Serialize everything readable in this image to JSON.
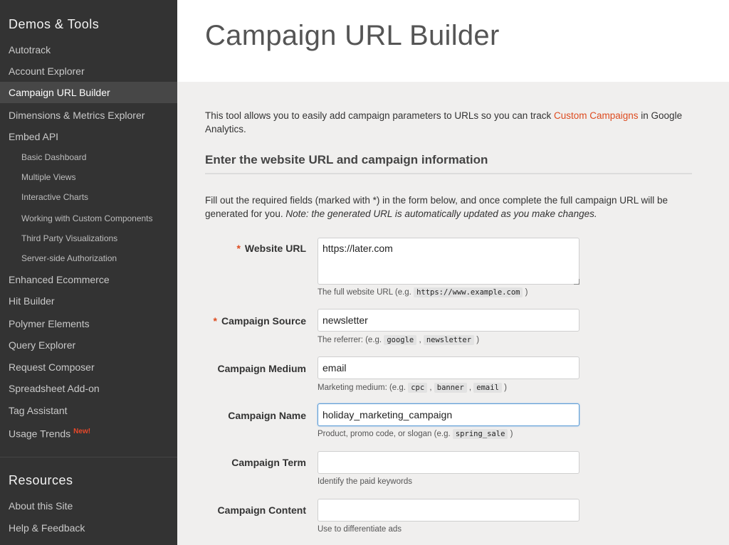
{
  "sidebar": {
    "heading": "Demos & Tools",
    "items": [
      {
        "label": "Autotrack"
      },
      {
        "label": "Account Explorer"
      },
      {
        "label": "Campaign URL Builder"
      },
      {
        "label": "Dimensions & Metrics Explorer"
      },
      {
        "label": "Embed API"
      },
      {
        "label": "Basic Dashboard"
      },
      {
        "label": "Multiple Views"
      },
      {
        "label": "Interactive Charts"
      },
      {
        "label": "Working with Custom Components"
      },
      {
        "label": "Third Party Visualizations"
      },
      {
        "label": "Server-side Authorization"
      },
      {
        "label": "Enhanced Ecommerce"
      },
      {
        "label": "Hit Builder"
      },
      {
        "label": "Polymer Elements"
      },
      {
        "label": "Query Explorer"
      },
      {
        "label": "Request Composer"
      },
      {
        "label": "Spreadsheet Add-on"
      },
      {
        "label": "Tag Assistant"
      },
      {
        "label": "Usage Trends",
        "badge": "New!"
      }
    ],
    "resources_heading": "Resources",
    "resources": [
      {
        "label": "About this Site"
      },
      {
        "label": "Help & Feedback"
      }
    ]
  },
  "header": {
    "title": "Campaign URL Builder"
  },
  "intro": {
    "text_before": "This tool allows you to easily add campaign parameters to URLs so you can track ",
    "link": "Custom Campaigns",
    "text_after": " in Google Analytics."
  },
  "section": {
    "title": "Enter the website URL and campaign information"
  },
  "instructions": {
    "text": "Fill out the required fields (marked with *) in the form below, and once complete the full campaign URL will be generated for you. ",
    "note": "Note: the generated URL is automatically updated as you make changes."
  },
  "form": {
    "required_marker": "*",
    "website_url": {
      "label": "Website URL",
      "value": "https://later.com",
      "help_prefix": "The full website URL (e.g. ",
      "help_code": "https://www.example.com",
      "help_suffix": " )"
    },
    "source": {
      "label": "Campaign Source",
      "value": "newsletter",
      "help_prefix": "The referrer: (e.g. ",
      "help_codes": [
        "google",
        "newsletter"
      ],
      "help_suffix": " )"
    },
    "medium": {
      "label": "Campaign Medium",
      "value": "email",
      "help_prefix": "Marketing medium: (e.g. ",
      "help_codes": [
        "cpc",
        "banner",
        "email"
      ],
      "help_suffix": " )"
    },
    "name": {
      "label": "Campaign Name",
      "value": "holiday_marketing_campaign",
      "help_prefix": "Product, promo code, or slogan (e.g. ",
      "help_code": "spring_sale",
      "help_suffix": " )"
    },
    "term": {
      "label": "Campaign Term",
      "value": "",
      "help": "Identify the paid keywords"
    },
    "content": {
      "label": "Campaign Content",
      "value": "",
      "help": "Use to differentiate ads"
    }
  },
  "colors": {
    "sidebar_bg": "#333333",
    "accent_link": "#dd4b1f",
    "focus_border": "#5a9bd5"
  }
}
